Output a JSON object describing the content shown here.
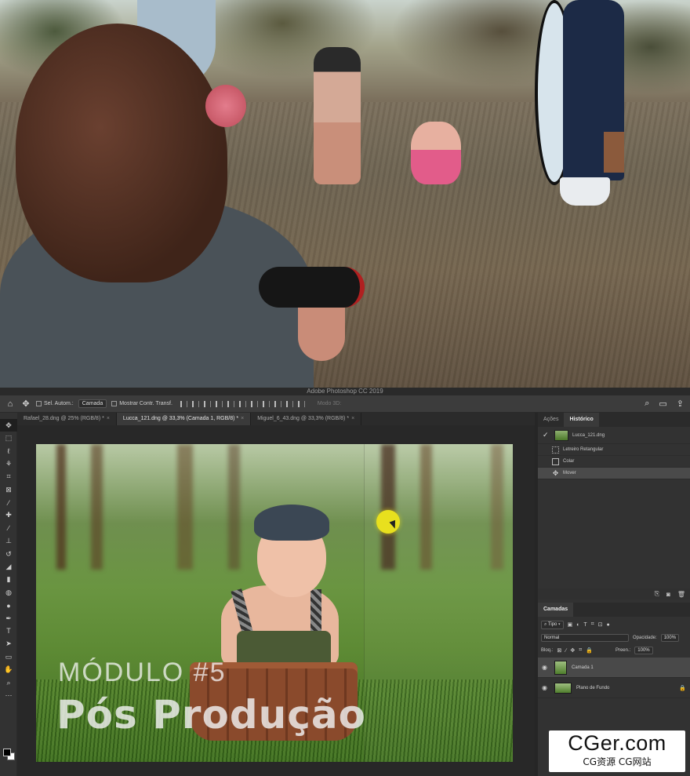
{
  "photoshop": {
    "window_title": "Adobe Photoshop CC 2019",
    "options_bar": {
      "auto_select_label": "Sel. Autom.:",
      "auto_select_value": "Camada",
      "show_transform_label": "Mostrar Contr. Transf.",
      "mode_3d_label": "Modo 3D:"
    },
    "tabs": [
      {
        "label": "Rafael_28.dng @ 25% (RGB/8) *",
        "close": "×"
      },
      {
        "label": "Lucca_121.dng @ 33,3% (Camada 1, RGB/8) *",
        "close": "×"
      },
      {
        "label": "Miguel_6_43.dng @ 33,3% (RGB/8) *",
        "close": "×"
      }
    ],
    "canvas": {
      "module_title": "MÓDULO #5",
      "module_subtitle": "Pós Produção"
    },
    "history_panel": {
      "tabs": [
        "Ações",
        "Histórico"
      ],
      "active_tab": "Histórico",
      "snapshot": "Lucca_121.dng",
      "steps": [
        "Letreiro Retangular",
        "Colar",
        "Mover"
      ],
      "current_step": "Mover"
    },
    "layers_panel": {
      "tab": "Camadas",
      "filter_label": "Tipo",
      "blend_mode": "Normal",
      "opacity_label": "Opacidade:",
      "opacity_value": "100%",
      "lock_label": "Bloq.:",
      "fill_label": "Preen.:",
      "fill_value": "100%",
      "layers": [
        {
          "name": "Camada 1",
          "selected": true
        },
        {
          "name": "Plano de Fundo",
          "selected": false,
          "locked": true
        }
      ]
    }
  },
  "watermark": {
    "main": "CGer.com",
    "sub": "CG资源 CG网站"
  },
  "colors": {
    "ps_dark": "#323232",
    "accent_yellow_cursor": "#e8e01e"
  },
  "icons": [
    "home-icon",
    "move-icon",
    "search-icon",
    "workspace-icon",
    "eye-icon",
    "lock-icon",
    "new-layer-icon",
    "trash-icon",
    "camera-icon"
  ]
}
